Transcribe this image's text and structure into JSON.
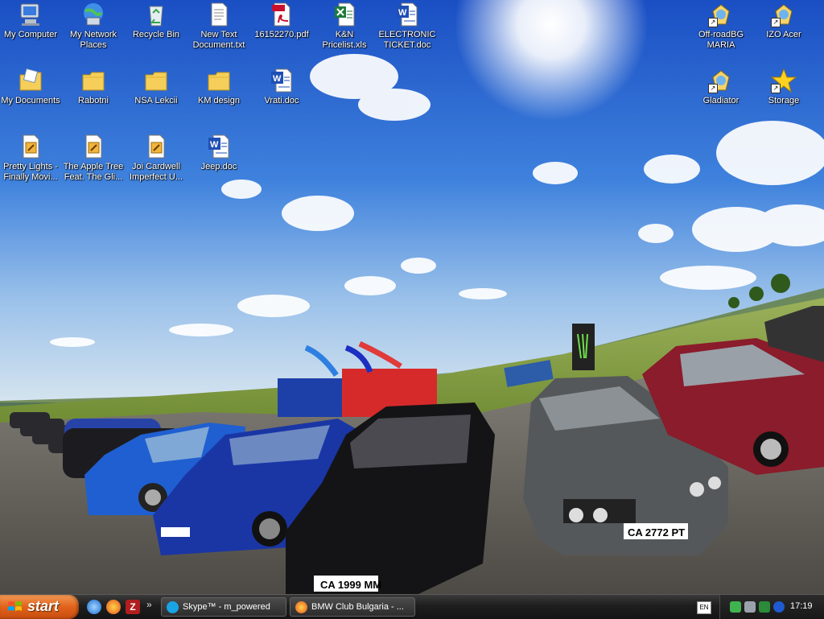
{
  "desktop": {
    "icons": [
      {
        "label": "My Computer",
        "icon": "my-computer-icon"
      },
      {
        "label": "My Network Places",
        "icon": "network-places-icon"
      },
      {
        "label": "Recycle Bin",
        "icon": "recycle-bin-icon"
      },
      {
        "label": "New Text Document.txt",
        "icon": "text-document-icon"
      },
      {
        "label": "16152270.pdf",
        "icon": "pdf-icon"
      },
      {
        "label": "K&N Pricelist.xls",
        "icon": "excel-icon"
      },
      {
        "label": "ELECTRONIC TICKET.doc",
        "icon": "word-document-icon"
      },
      {
        "label": "My Documents",
        "icon": "my-documents-icon"
      },
      {
        "label": "Rabotni",
        "icon": "folder-icon"
      },
      {
        "label": "NSA Lekcii",
        "icon": "folder-icon"
      },
      {
        "label": "KM design",
        "icon": "folder-icon"
      },
      {
        "label": "Vrati.doc",
        "icon": "word-document-icon"
      },
      {
        "label": "Pretty Lights - Finally Movi...",
        "icon": "media-file-icon"
      },
      {
        "label": "The Apple Tree Feat. The Gli...",
        "icon": "media-file-icon"
      },
      {
        "label": "Joi Cardwell Imperfect U...",
        "icon": "media-file-icon"
      },
      {
        "label": "Jeep.doc",
        "icon": "word-document-icon"
      },
      {
        "label": "Off-roadBG MARIA",
        "icon": "shortcut-icon"
      },
      {
        "label": "IZO Acer",
        "icon": "shortcut-icon"
      },
      {
        "label": "Gladiator",
        "icon": "shortcut-icon"
      },
      {
        "label": "Storage",
        "icon": "star-shortcut-icon"
      }
    ]
  },
  "taskbar": {
    "start_label": "start",
    "quick_launch": [
      "ie-icon",
      "firefox-icon",
      "filezilla-icon"
    ],
    "more_label": "»",
    "tasks": [
      {
        "label": "Skype™ - m_powered",
        "icon": "skype-icon"
      },
      {
        "label": "BMW Club Bulgaria - ...",
        "icon": "firefox-icon"
      }
    ],
    "language": "EN",
    "tray_icons": [
      "security-shield-icon",
      "network-icon",
      "antivirus-icon",
      "bluetooth-icon"
    ],
    "clock": "17:19"
  },
  "colors": {
    "sky_top": "#1e56c8",
    "sky_bottom": "#bcd6ee",
    "taskbar": "#1e1e1e",
    "start": "#e0621b",
    "grass": "#7e9a3c",
    "asphalt": "#5e5b56"
  }
}
